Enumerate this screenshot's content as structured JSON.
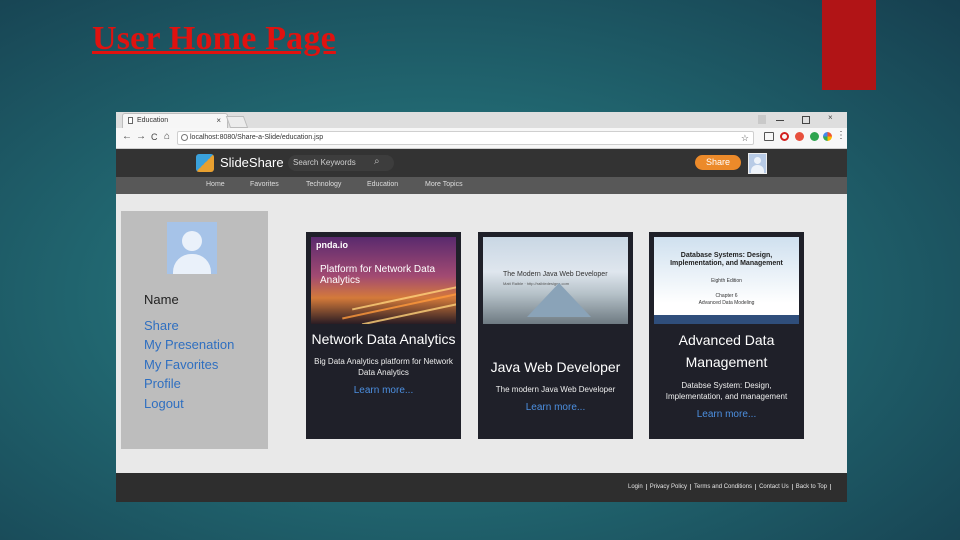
{
  "slide": {
    "title": "User Home Page"
  },
  "browser": {
    "tab_title": "Education",
    "close_glyph": "×",
    "url": "localhost:8080/Share-a-Slide/education.jsp",
    "nav_glyphs": {
      "back": "←",
      "forward": "→",
      "reload": "C",
      "home": "⌂"
    }
  },
  "header": {
    "brand": "SlideShare",
    "search_placeholder": "Search Keywords",
    "share_label": "Share"
  },
  "nav": {
    "items": [
      "Home",
      "Favorites",
      "Technology",
      "Education",
      "More Topics"
    ]
  },
  "sidebar": {
    "name": "Name",
    "links": [
      "Share",
      "My Presenation",
      "My Favorites",
      "Profile",
      "Logout"
    ]
  },
  "cards": [
    {
      "title": "Network Data Analytics",
      "desc": "Big Data Analytics platform for Network Data Analytics",
      "link": "Learn more...",
      "thumb_logo": "pnda.io",
      "thumb_title": "Platform for Network Data Analytics"
    },
    {
      "title": "Java Web Developer",
      "desc": "The modern Java Web Developer",
      "link": "Learn more...",
      "thumb_title": "The Modern Java Web Developer",
      "thumb_sub": "Matt Raible · http://raibledesigns.com"
    },
    {
      "title": "Advanced Data Management",
      "desc": "Databse System: Design, Implementation, and management",
      "link": "Learn more...",
      "thumb_title": "Database Systems: Design, Implementation, and Management",
      "thumb_edition": "Eighth Edition",
      "thumb_chapter": "Chapter 6",
      "thumb_chapter_title": "Advanced Data Modeling"
    }
  ],
  "footer": {
    "links": [
      "Login",
      "Privacy Policy",
      "Terms and Conditions",
      "Contact Us",
      "Back to Top"
    ]
  },
  "colors": {
    "title_red": "#e0120f",
    "accent_red": "#b11416",
    "share_orange": "#ec8a2a",
    "link_blue": "#2f6fc0"
  }
}
